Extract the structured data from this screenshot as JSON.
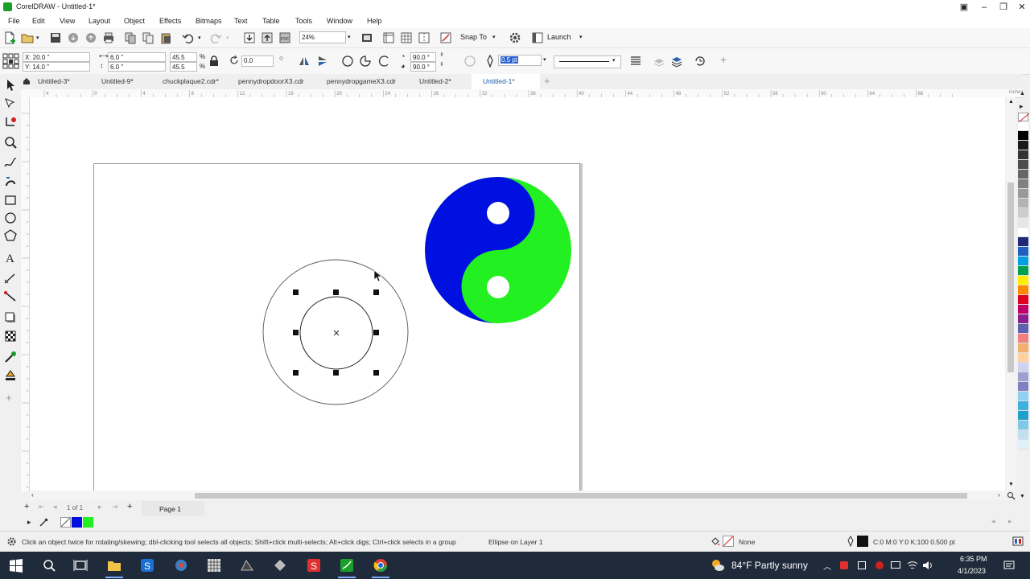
{
  "window": {
    "title": "CorelDRAW - Untitled-1*"
  },
  "menu": [
    "File",
    "Edit",
    "View",
    "Layout",
    "Object",
    "Effects",
    "Bitmaps",
    "Text",
    "Table",
    "Tools",
    "Window",
    "Help"
  ],
  "toolbar": {
    "zoom": "24%",
    "snap_label": "Snap To",
    "launch_label": "Launch"
  },
  "propbar": {
    "x": "X: 20.0 \"",
    "y": "Y: 14.0 \"",
    "w": "6.0 \"",
    "h": "6.0 \"",
    "scale_w": "45.5",
    "scale_h": "45.5",
    "pct1": "%",
    "pct2": "%",
    "rotation": "0.0",
    "start_angle": "90.0 °",
    "end_angle": "90.0 °",
    "outline_width": "0.5 pt"
  },
  "tabs": [
    {
      "label": "Untitled-3*"
    },
    {
      "label": "Untitled-9*"
    },
    {
      "label": "chuckplaque2.cdr*"
    },
    {
      "label": "pennydropdoorX3.cdr"
    },
    {
      "label": "pennydropgameX3.cdr"
    },
    {
      "label": "Untitled-2*"
    },
    {
      "label": "Untitled-1*"
    }
  ],
  "ruler": {
    "labels": [
      "4",
      "0",
      "4",
      "8",
      "12",
      "16",
      "20",
      "24",
      "28",
      "32",
      "36",
      "40",
      "44",
      "48",
      "52",
      "56",
      "60",
      "64",
      "68"
    ],
    "units": "inches"
  },
  "pagenav": {
    "count": "1 of 1",
    "page_tab": "Page 1"
  },
  "status": {
    "hint": "Click an object twice for rotating/skewing; dbl-clicking tool selects all objects; Shift+click multi-selects; Alt+click digs; Ctrl+click selects in a group",
    "object_info": "Ellipse on Layer 1",
    "fill_label": "None",
    "outline_info": "C:0 M:0 Y:0 K:100  0.500 pt"
  },
  "taskbar": {
    "weather": "84°F  Partly sunny",
    "time": "6:35 PM",
    "date": "4/1/2023"
  },
  "colors": {
    "yin_blue": "#0010e0",
    "yang_green": "#22f020",
    "accent": "#1e5aa8"
  },
  "palette_colors": [
    "#ffffff",
    "#000000",
    "#1a1a1a",
    "#333333",
    "#4d4d4d",
    "#666666",
    "#808080",
    "#999999",
    "#b3b3b3",
    "#cccccc",
    "#e6e6e6",
    "#ffffff",
    "#1e2a78",
    "#2060c0",
    "#00a0e0",
    "#00a050",
    "#ffee00",
    "#ff8800",
    "#e00020",
    "#c0006a",
    "#8a2090",
    "#6060b0",
    "#f08080",
    "#f0b070",
    "#ffd0a0",
    "#d0d0f0",
    "#a0a0d0",
    "#8080c0",
    "#90d0f0",
    "#40b0e0",
    "#20a0c8",
    "#80c8e8",
    "#c0e0f0",
    "#e0f0f8"
  ]
}
